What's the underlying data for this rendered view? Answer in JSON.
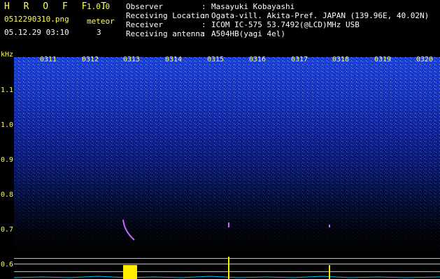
{
  "header": {
    "app_name": "H R O F F T",
    "version": "1.0.0",
    "file_name": "0512290310.png",
    "date_time": "05.12.29 03:10",
    "meteor_label": "meteor",
    "meteor_count": "3",
    "info": [
      {
        "key": "Observer",
        "sep": ":",
        "value": "Masayuki Kobayashi"
      },
      {
        "key": "Receiving Location",
        "sep": ":",
        "value": "Ogata-vill. Akita-Pref. JAPAN (139.96E, 40.02N)"
      },
      {
        "key": "Receiver",
        "sep": ":",
        "value": "ICOM IC-575 53.7492(@LCD)MHz USB"
      },
      {
        "key": "Receiving antenna",
        "sep": ":",
        "value": "A504HB(yagi 4el)"
      }
    ]
  },
  "axes": {
    "y_unit": "kHz",
    "y_ticks": [
      "1.1",
      "1.0",
      "0.9",
      "0.8",
      "0.7",
      "0.6"
    ],
    "x_ticks": [
      "0311",
      "0312",
      "0313",
      "0314",
      "0315",
      "0316",
      "0317",
      "0318",
      "0319",
      "0320"
    ]
  },
  "colors": {
    "label": "#ffff55",
    "text": "#ffffff",
    "spectrum_top": "#1a3fd6",
    "meteor_trace": "#ffee00",
    "baseline": "#00c8ff"
  }
}
